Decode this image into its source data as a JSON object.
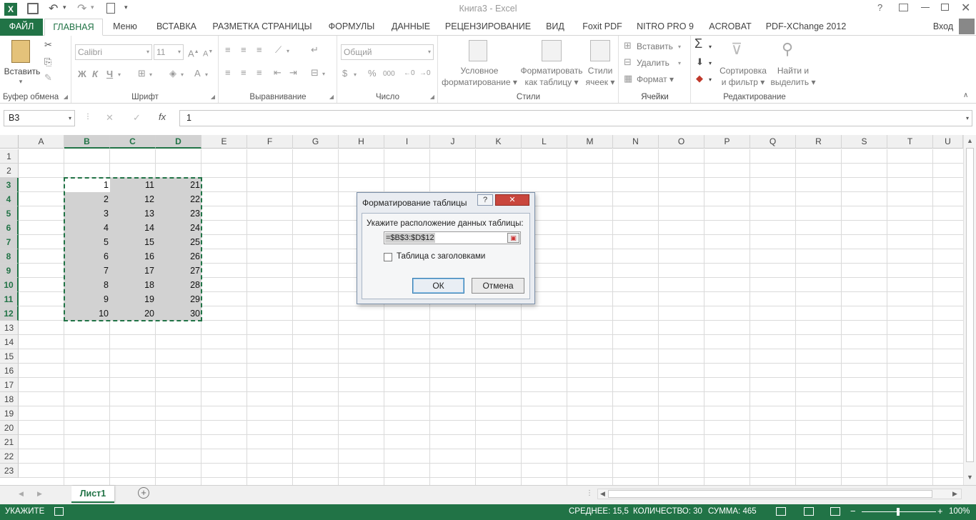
{
  "app": {
    "title": "Книга3 - Excel"
  },
  "tabs": [
    "ФАЙЛ",
    "ГЛАВНАЯ",
    "Меню",
    "ВСТАВКА",
    "РАЗМЕТКА СТРАНИЦЫ",
    "ФОРМУЛЫ",
    "ДАННЫЕ",
    "РЕЦЕНЗИРОВАНИЕ",
    "ВИД",
    "Foxit PDF",
    "NITRO PRO 9",
    "ACROBAT",
    "PDF-XChange 2012"
  ],
  "signin": "Вход",
  "ribbon": {
    "clipboard": {
      "paste": "Вставить",
      "label": "Буфер обмена"
    },
    "font": {
      "name": "Calibri",
      "size": "11",
      "label": "Шрифт",
      "bold": "Ж",
      "italic": "К",
      "underline": "Ч"
    },
    "alignment": {
      "label": "Выравнивание"
    },
    "number": {
      "format": "Общий",
      "label": "Число",
      "percent": "%",
      "thousands": "000"
    },
    "styles": {
      "cond1": "Условное",
      "cond2": "форматирование",
      "fmt1": "Форматировать",
      "fmt2": "как таблицу",
      "st1": "Стили",
      "st2": "ячеек",
      "label": "Стили"
    },
    "cells": {
      "insert": "Вставить",
      "delete": "Удалить",
      "format": "Формат",
      "label": "Ячейки"
    },
    "editing": {
      "sort1": "Сортировка",
      "sort2": "и фильтр",
      "find1": "Найти и",
      "find2": "выделить",
      "label": "Редактирование"
    }
  },
  "formula_bar": {
    "name_box": "B3",
    "value": "1"
  },
  "columns": [
    "A",
    "B",
    "C",
    "D",
    "E",
    "F",
    "G",
    "H",
    "I",
    "J",
    "K",
    "L",
    "M",
    "N",
    "O",
    "P",
    "Q",
    "R",
    "S",
    "T",
    "U"
  ],
  "rows": [
    "1",
    "2",
    "3",
    "4",
    "5",
    "6",
    "7",
    "8",
    "9",
    "10",
    "11",
    "12",
    "13",
    "14",
    "15",
    "16",
    "17",
    "18",
    "19",
    "20",
    "21",
    "22",
    "23"
  ],
  "cells": {
    "B": [
      "1",
      "2",
      "3",
      "4",
      "5",
      "6",
      "7",
      "8",
      "9",
      "10"
    ],
    "C": [
      "11",
      "12",
      "13",
      "14",
      "15",
      "16",
      "17",
      "18",
      "19",
      "20"
    ],
    "D": [
      "21",
      "22",
      "23",
      "24",
      "25",
      "26",
      "27",
      "28",
      "29",
      "30"
    ]
  },
  "dialog": {
    "title": "Форматирование таблицы",
    "help": "?",
    "prompt": "Укажите расположение данных таблицы:",
    "range": "=$B$3:$D$12",
    "checkbox": "Таблица с заголовками",
    "ok": "ОК",
    "cancel": "Отмена"
  },
  "sheet_tab": "Лист1",
  "status": {
    "mode": "УКАЖИТЕ",
    "average": "СРЕДНЕЕ: 15,5",
    "count": "КОЛИЧЕСТВО: 30",
    "sum": "СУММА: 465",
    "zoom": "100%"
  },
  "colors": {
    "accent": "#217346",
    "selection": "#d2d2d2"
  }
}
